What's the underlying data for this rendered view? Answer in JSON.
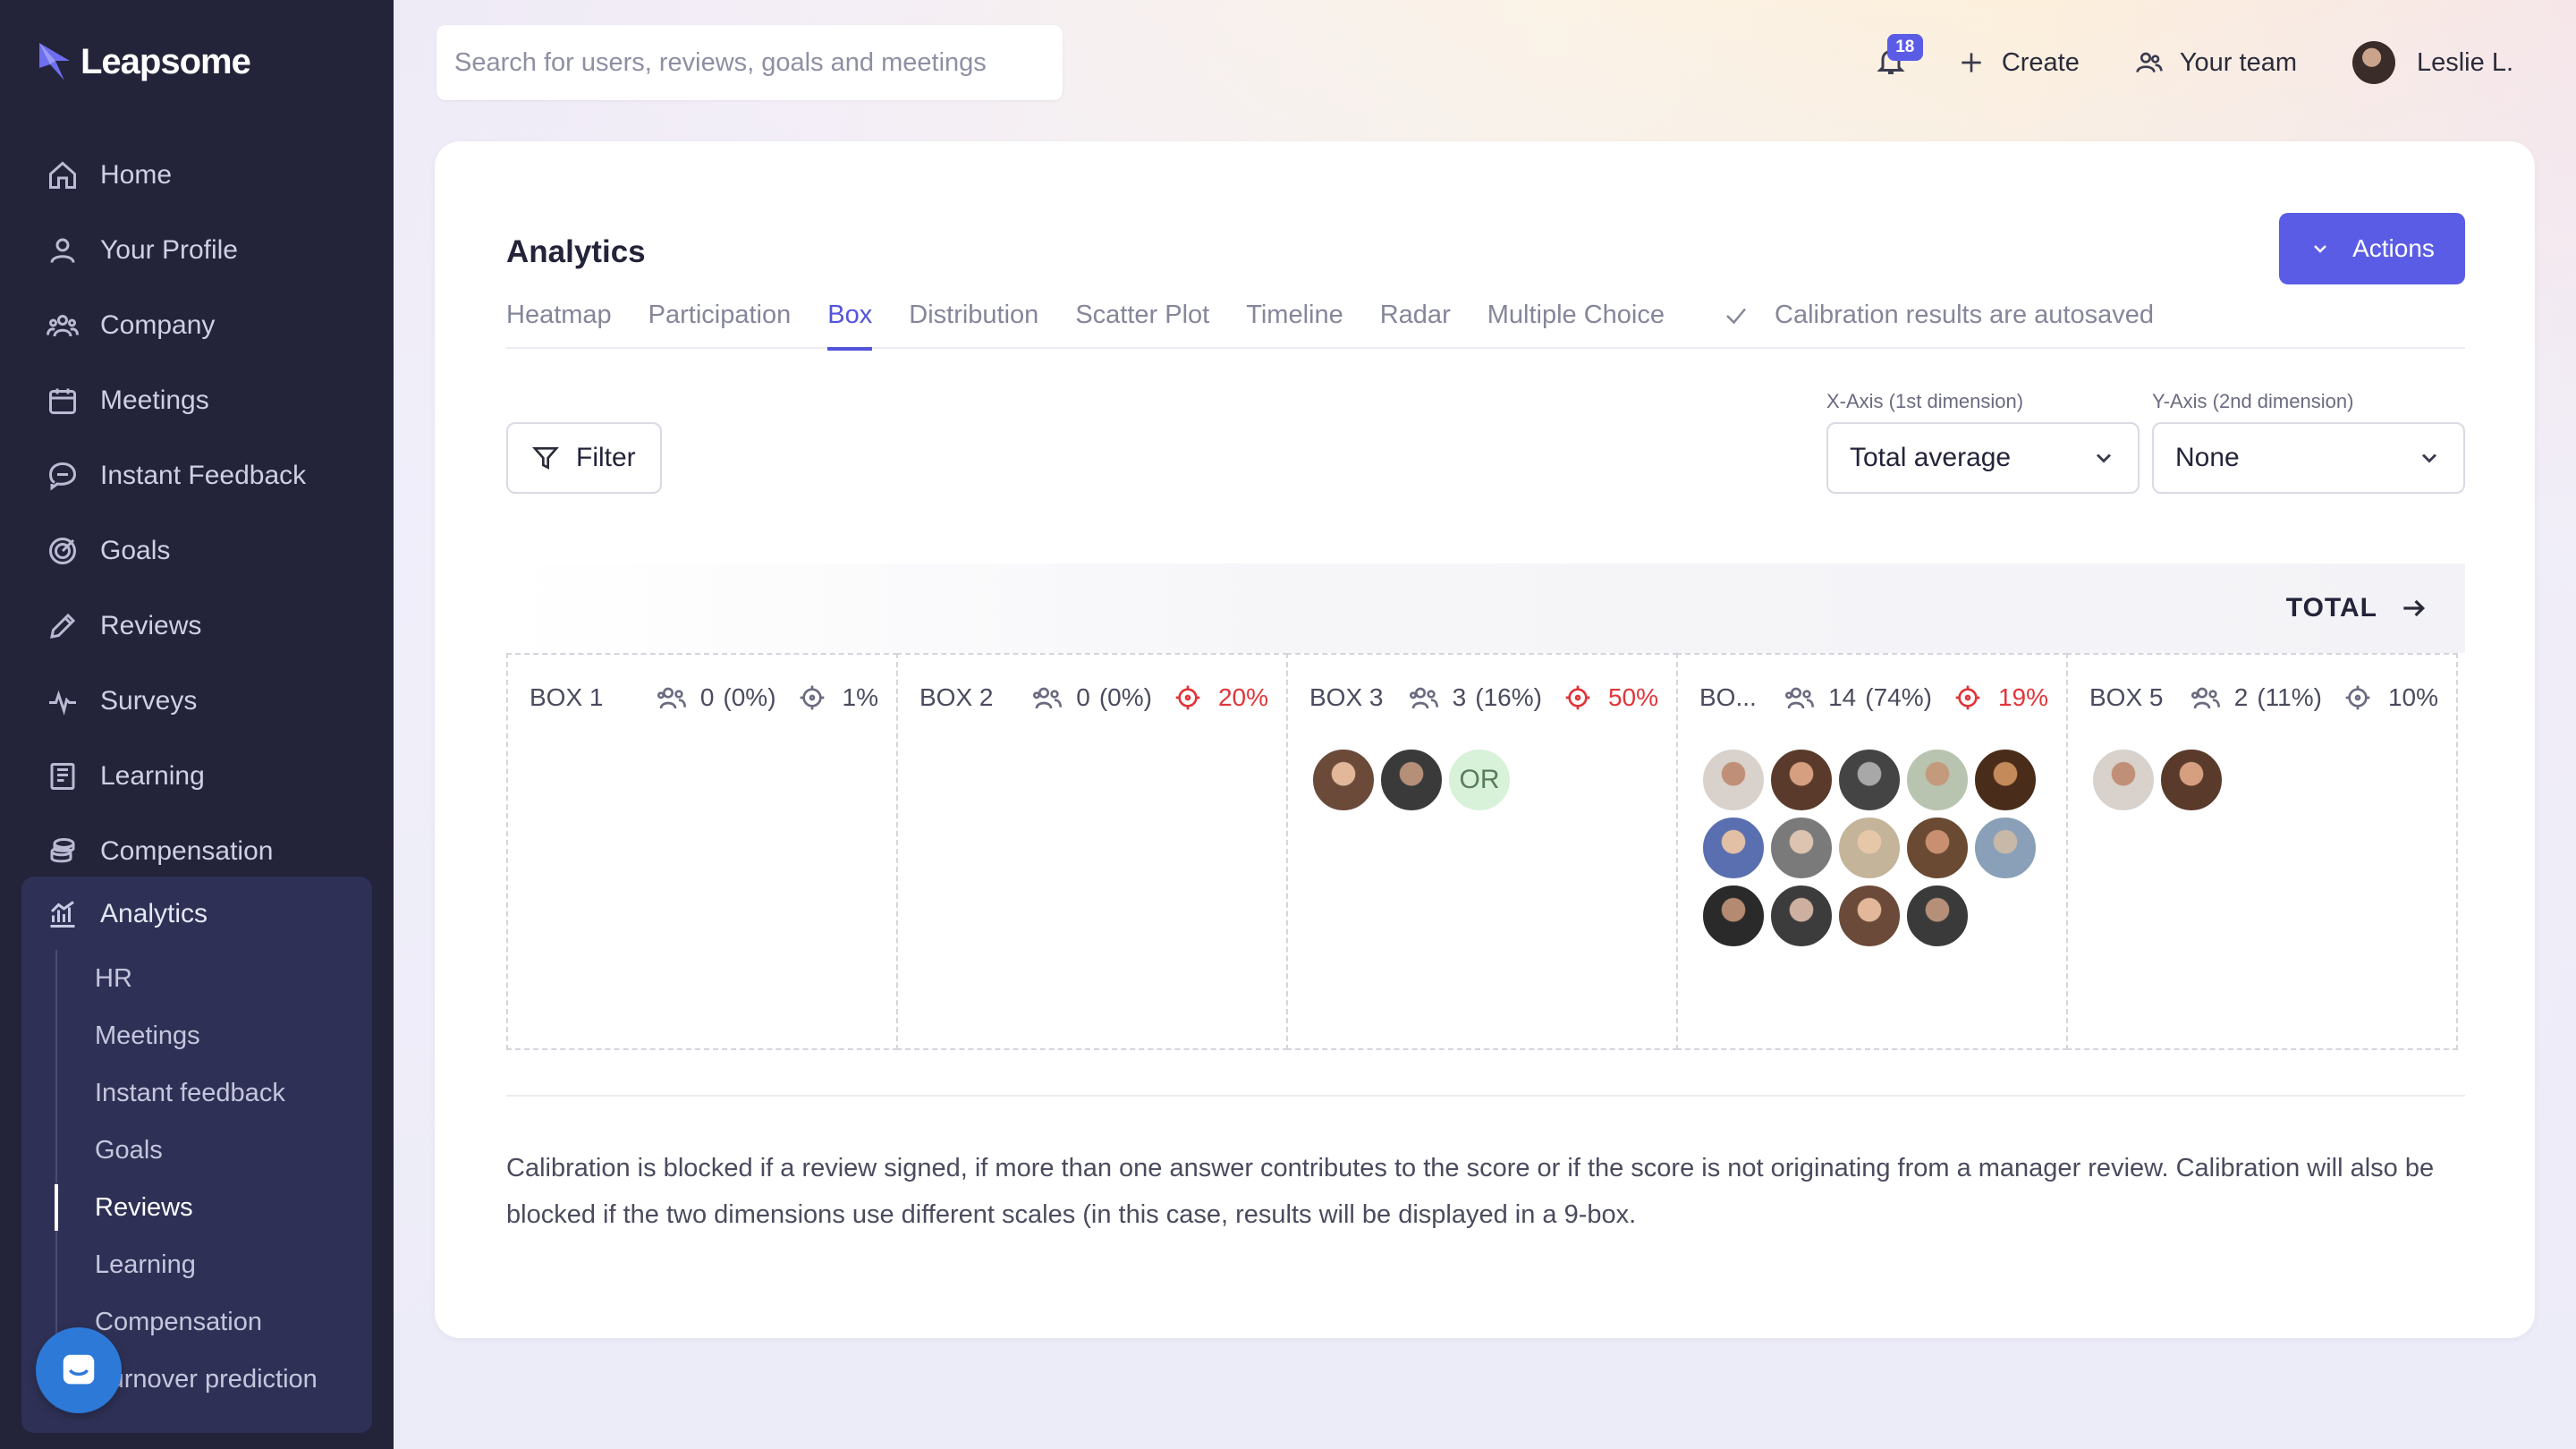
{
  "app": {
    "name": "Leapsome"
  },
  "sidebar": {
    "items": [
      {
        "label": "Home",
        "icon": "home-icon"
      },
      {
        "label": "Your Profile",
        "icon": "user-icon"
      },
      {
        "label": "Company",
        "icon": "people-icon"
      },
      {
        "label": "Meetings",
        "icon": "calendar-icon"
      },
      {
        "label": "Instant Feedback",
        "icon": "chat-icon"
      },
      {
        "label": "Goals",
        "icon": "target-icon"
      },
      {
        "label": "Reviews",
        "icon": "pencil-icon"
      },
      {
        "label": "Surveys",
        "icon": "pulse-icon"
      },
      {
        "label": "Learning",
        "icon": "book-icon"
      },
      {
        "label": "Compensation",
        "icon": "coins-icon"
      }
    ],
    "analytics": {
      "label": "Analytics",
      "icon": "bar-chart-icon",
      "sub": [
        {
          "label": "HR"
        },
        {
          "label": "Meetings"
        },
        {
          "label": "Instant feedback"
        },
        {
          "label": "Goals"
        },
        {
          "label": "Reviews",
          "active": true
        },
        {
          "label": "Learning"
        },
        {
          "label": "Compensation"
        },
        {
          "label": "Turnover prediction"
        }
      ]
    }
  },
  "topbar": {
    "search_placeholder": "Search for users, reviews, goals and meetings",
    "notifications_count": "18",
    "create_label": "Create",
    "team_label": "Your team",
    "user_name": "Leslie L."
  },
  "page": {
    "title": "Analytics",
    "actions_label": "Actions",
    "tabs": [
      "Heatmap",
      "Participation",
      "Box",
      "Distribution",
      "Scatter Plot",
      "Timeline",
      "Radar",
      "Multiple Choice"
    ],
    "active_tab": "Box",
    "autosave_text": "Calibration results are autosaved",
    "filter_label": "Filter",
    "x_axis": {
      "label": "X-Axis (1st dimension)",
      "value": "Total average"
    },
    "y_axis": {
      "label": "Y-Axis (2nd dimension)",
      "value": "None"
    },
    "total_label": "TOTAL",
    "boxes": [
      {
        "name": "BOX 1",
        "count": "0",
        "share": "(0%)",
        "target": "1%",
        "target_alert": false,
        "avatars": []
      },
      {
        "name": "BOX 2",
        "count": "0",
        "share": "(0%)",
        "target": "20%",
        "target_alert": true,
        "avatars": []
      },
      {
        "name": "BOX 3",
        "count": "3",
        "share": "(16%)",
        "target": "50%",
        "target_alert": true,
        "avatars": [
          "photo",
          "photo",
          "OR"
        ]
      },
      {
        "name": "BO...",
        "count": "14",
        "share": "(74%)",
        "target": "19%",
        "target_alert": true,
        "avatars": [
          "photo",
          "photo",
          "photo",
          "photo",
          "photo",
          "photo",
          "photo",
          "photo",
          "photo",
          "photo",
          "photo",
          "photo",
          "photo",
          "photo"
        ]
      },
      {
        "name": "BOX 5",
        "count": "2",
        "share": "(11%)",
        "target": "10%",
        "target_alert": false,
        "avatars": [
          "photo",
          "photo"
        ]
      }
    ],
    "note": "Calibration is blocked if a review signed, if more than one answer contributes to the score or if the score is not originating from a manager review. Calibration will also be blocked if the two dimensions use different scales (in this case, results will be displayed in a 9-box."
  },
  "colors": {
    "accent": "#5b5ce6",
    "sidebar_bg": "#232339",
    "alert": "#e0353a",
    "chat": "#2c79d8"
  }
}
